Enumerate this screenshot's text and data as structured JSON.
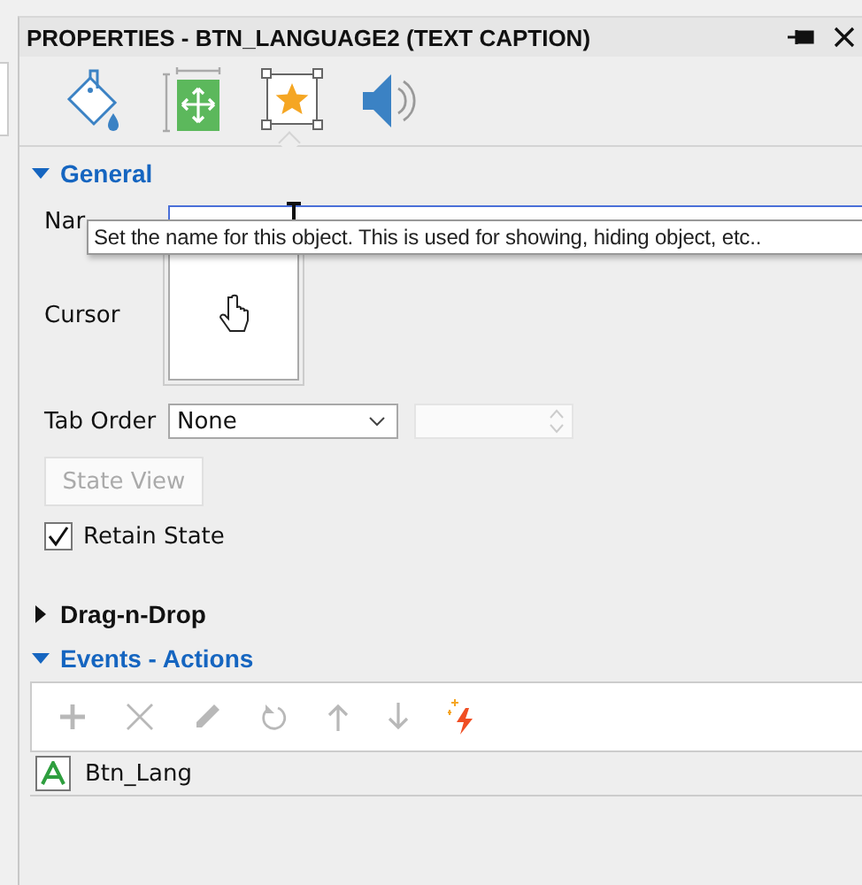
{
  "panel": {
    "title": "PROPERTIES - BTN_LANGUAGE2 (TEXT CAPTION)"
  },
  "tabs": [
    {
      "kind": "fill",
      "selected": false
    },
    {
      "kind": "position",
      "selected": false
    },
    {
      "kind": "actions",
      "selected": true
    },
    {
      "kind": "audio",
      "selected": false
    }
  ],
  "general": {
    "title": "General",
    "expanded": true,
    "name_label": "Nar",
    "tooltip": "Set the name for this object. This is used for showing, hiding object, etc..",
    "cursor_label": "Cursor",
    "tab_order_label": "Tab Order",
    "tab_order_value": "None",
    "state_view_button": {
      "label": "State View",
      "disabled": true
    },
    "retain_state": {
      "label": "Retain State",
      "checked": true
    }
  },
  "drag_n_drop": {
    "title": "Drag-n-Drop",
    "expanded": false
  },
  "events": {
    "title": "Events - Actions",
    "expanded": true,
    "toolbar": [
      {
        "kind": "add",
        "disabled": true
      },
      {
        "kind": "delete",
        "disabled": true
      },
      {
        "kind": "edit",
        "disabled": true
      },
      {
        "kind": "undo",
        "disabled": true
      },
      {
        "kind": "up",
        "disabled": true
      },
      {
        "kind": "down",
        "disabled": true
      },
      {
        "kind": "magic",
        "disabled": false
      }
    ],
    "items": [
      {
        "label": "Btn_Lang"
      }
    ]
  }
}
